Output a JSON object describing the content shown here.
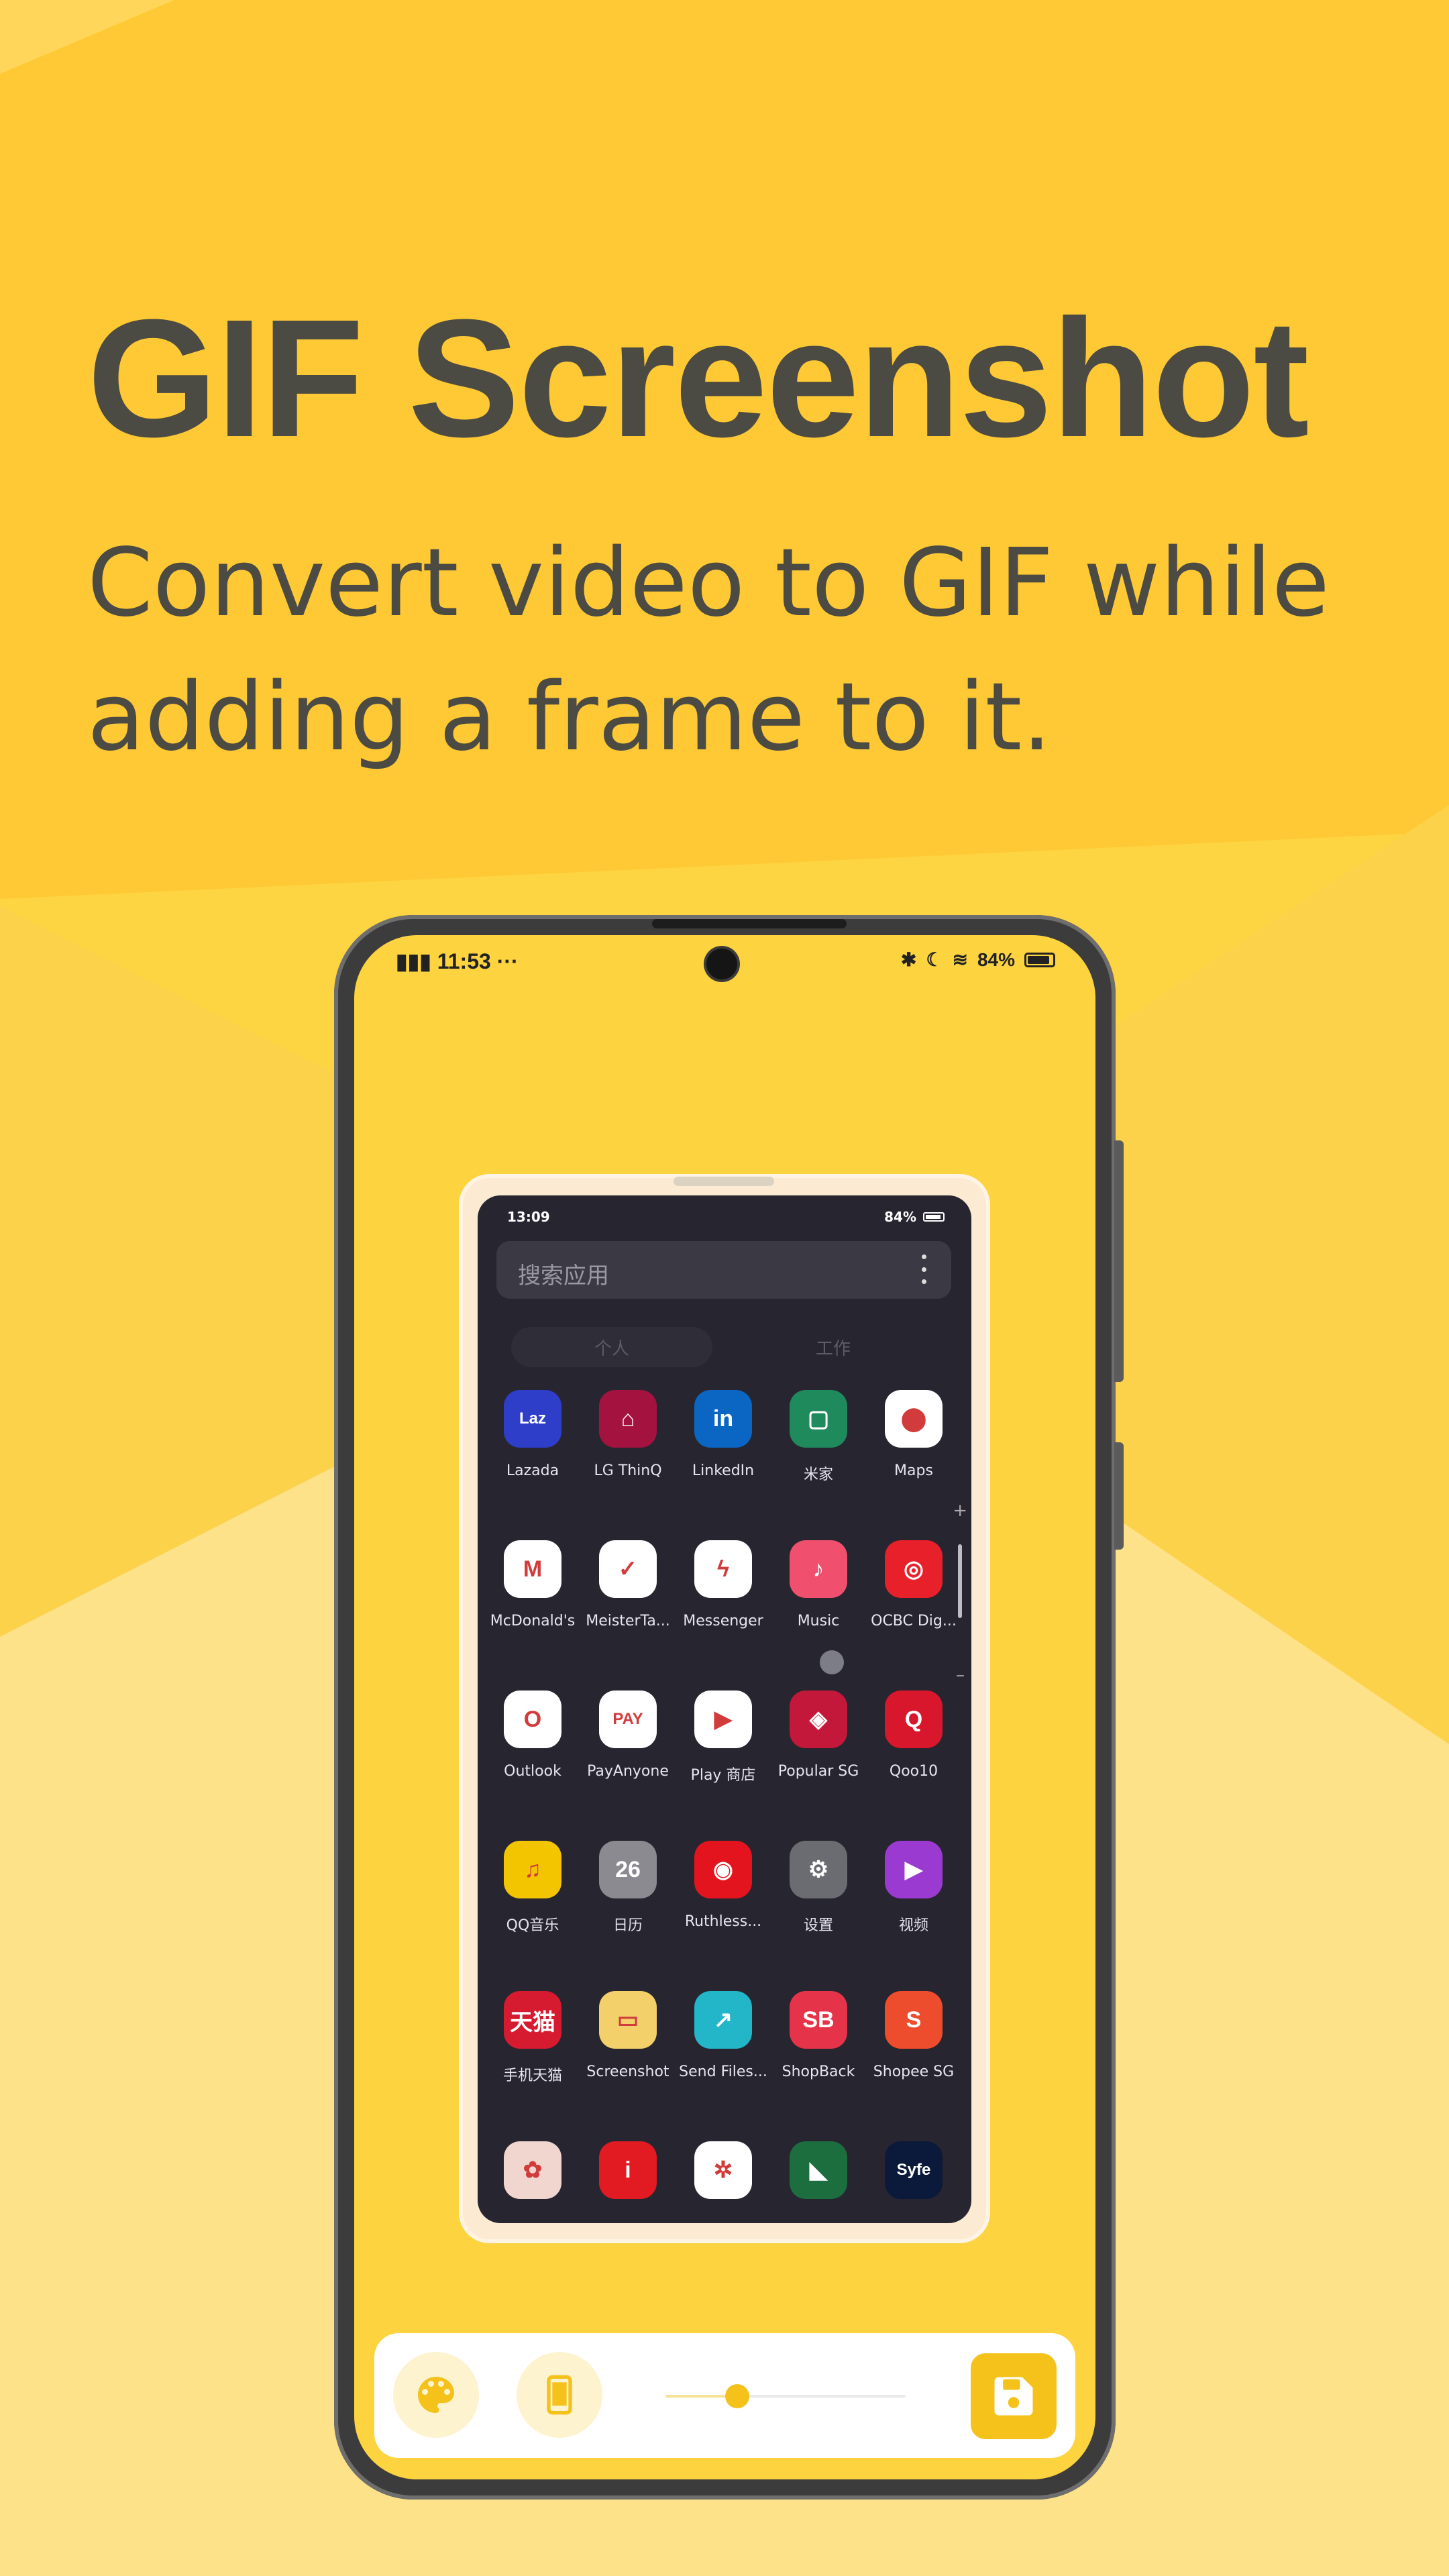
{
  "headline": "GIF Screenshot",
  "subline": "Convert video to GIF while adding a frame to it.",
  "colors": {
    "background": "#fdd441",
    "accent": "#f4c21b",
    "text": "#4b4a43",
    "inner_bg": "#262530"
  },
  "phone_status": {
    "time": "11:53",
    "left_icons": "signal-4g-icon",
    "more": "···",
    "battery": "84%"
  },
  "inner_status": {
    "time": "13:09",
    "battery": "84%"
  },
  "search": {
    "placeholder": "搜索应用"
  },
  "tabs": {
    "personal": "个人",
    "work": "工作"
  },
  "apps": [
    {
      "label": "Lazada",
      "icon": "lazada-icon",
      "glyph": "Laz",
      "color": "#2f3ec9"
    },
    {
      "label": "LG ThinQ",
      "icon": "lg-thinq-icon",
      "glyph": "⌂",
      "color": "#a4123f"
    },
    {
      "label": "LinkedIn",
      "icon": "linkedin-icon",
      "glyph": "in",
      "color": "#0a66c2"
    },
    {
      "label": "米家",
      "icon": "mijia-icon",
      "glyph": "▢",
      "color": "#1f8a5c"
    },
    {
      "label": "Maps",
      "icon": "maps-icon",
      "glyph": "⬤",
      "color": "#ffffff"
    },
    {
      "label": "McDonald's",
      "icon": "mcdonalds-icon",
      "glyph": "M",
      "color": "#ffffff"
    },
    {
      "label": "MeisterTa...",
      "icon": "meistertask-icon",
      "glyph": "✓",
      "color": "#ffffff"
    },
    {
      "label": "Messenger",
      "icon": "messenger-icon",
      "glyph": "ϟ",
      "color": "#ffffff"
    },
    {
      "label": "Music",
      "icon": "music-icon",
      "glyph": "♪",
      "color": "#f0506e"
    },
    {
      "label": "OCBC Dig...",
      "icon": "ocbc-icon",
      "glyph": "◎",
      "color": "#e8202a"
    },
    {
      "label": "Outlook",
      "icon": "outlook-icon",
      "glyph": "O",
      "color": "#ffffff"
    },
    {
      "label": "PayAnyone",
      "icon": "payanyone-icon",
      "glyph": "PAY",
      "color": "#ffffff"
    },
    {
      "label": "Play 商店",
      "icon": "play-store-icon",
      "glyph": "▶",
      "color": "#ffffff"
    },
    {
      "label": "Popular SG",
      "icon": "popular-icon",
      "glyph": "◈",
      "color": "#c4183a"
    },
    {
      "label": "Qoo10",
      "icon": "qoo10-icon",
      "glyph": "Q",
      "color": "#d8162c"
    },
    {
      "label": "QQ音乐",
      "icon": "qq-music-icon",
      "glyph": "♫",
      "color": "#f2c500"
    },
    {
      "label": "日历",
      "icon": "calendar-icon",
      "glyph": "26",
      "color": "#8a8a90"
    },
    {
      "label": "Ruthless...",
      "icon": "ruthless-icon",
      "glyph": "◉",
      "color": "#e4141f"
    },
    {
      "label": "设置",
      "icon": "settings-icon",
      "glyph": "⚙",
      "color": "#6b6b72"
    },
    {
      "label": "视频",
      "icon": "video-icon",
      "glyph": "▶",
      "color": "#9a3ad0"
    },
    {
      "label": "手机天猫",
      "icon": "tmall-icon",
      "glyph": "天猫",
      "color": "#d61a2f"
    },
    {
      "label": "Screenshot",
      "icon": "screenshot-icon",
      "glyph": "▭",
      "color": "#f3d06a"
    },
    {
      "label": "Send Files...",
      "icon": "send-files-icon",
      "glyph": "↗",
      "color": "#22b6c8"
    },
    {
      "label": "ShopBack",
      "icon": "shopback-icon",
      "glyph": "SB",
      "color": "#e5344a"
    },
    {
      "label": "Shopee SG",
      "icon": "shopee-icon",
      "glyph": "S",
      "color": "#ee4d2d"
    },
    {
      "label": "",
      "icon": "shopportal-icon",
      "glyph": "✿",
      "color": "#f1d6d0"
    },
    {
      "label": "",
      "icon": "info-icon",
      "glyph": "i",
      "color": "#e21a22"
    },
    {
      "label": "",
      "icon": "share-network-icon",
      "glyph": "✲",
      "color": "#ffffff"
    },
    {
      "label": "",
      "icon": "green-app-icon",
      "glyph": "◣",
      "color": "#1d6e3f"
    },
    {
      "label": "",
      "icon": "syfe-icon",
      "glyph": "Syfe",
      "color": "#0b1a3a"
    }
  ],
  "toolbar": {
    "palette_icon": "palette-icon",
    "device_icon": "phone-frame-icon",
    "save_icon": "save-icon",
    "slider_value": 0.3
  }
}
